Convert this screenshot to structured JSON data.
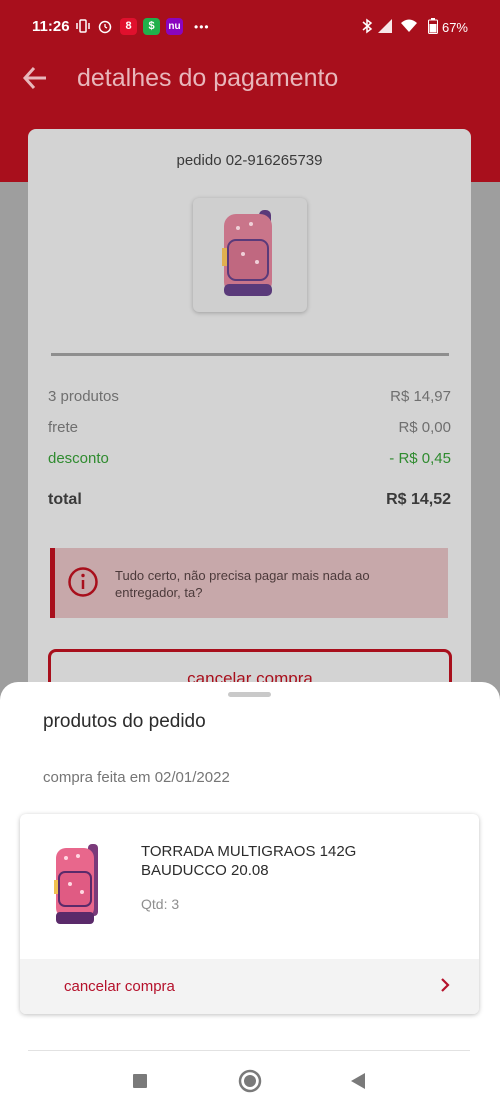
{
  "status_bar": {
    "time": "11:26",
    "battery": "67%",
    "icons": [
      "vibrate-icon",
      "alarm-icon",
      "app-icon-red",
      "app-icon-green",
      "nubank-icon",
      "more-icon",
      "bluetooth-icon",
      "signal-icon",
      "wifi-icon",
      "battery-icon"
    ],
    "app_green_label": "$",
    "app_nu_label": "nu",
    "app_red_label": "8",
    "more_label": "•••"
  },
  "header": {
    "title": "detalhes do pagamento"
  },
  "order": {
    "number": "pedido 02-916265739",
    "summary": {
      "products_label": "3 produtos",
      "products_value": "R$ 14,97",
      "shipping_label": "frete",
      "shipping_value": "R$ 0,00",
      "discount_label": "desconto",
      "discount_value": "- R$ 0,45",
      "total_label": "total",
      "total_value": "R$ 14,52"
    },
    "alert_text": "Tudo certo, não precisa pagar mais nada ao entregador, ta?",
    "cancel_label": "cancelar compra"
  },
  "sheet": {
    "title": "produtos do pedido",
    "date": "compra feita em 02/01/2022",
    "product": {
      "name": "TORRADA MULTIGRAOS 142G BAUDUCCO 20.08",
      "qty": "Qtd: 3"
    },
    "cancel_label": "cancelar compra"
  },
  "colors": {
    "brand": "#a80f1c",
    "discount": "#2f8b2f",
    "link": "#b5112b"
  }
}
